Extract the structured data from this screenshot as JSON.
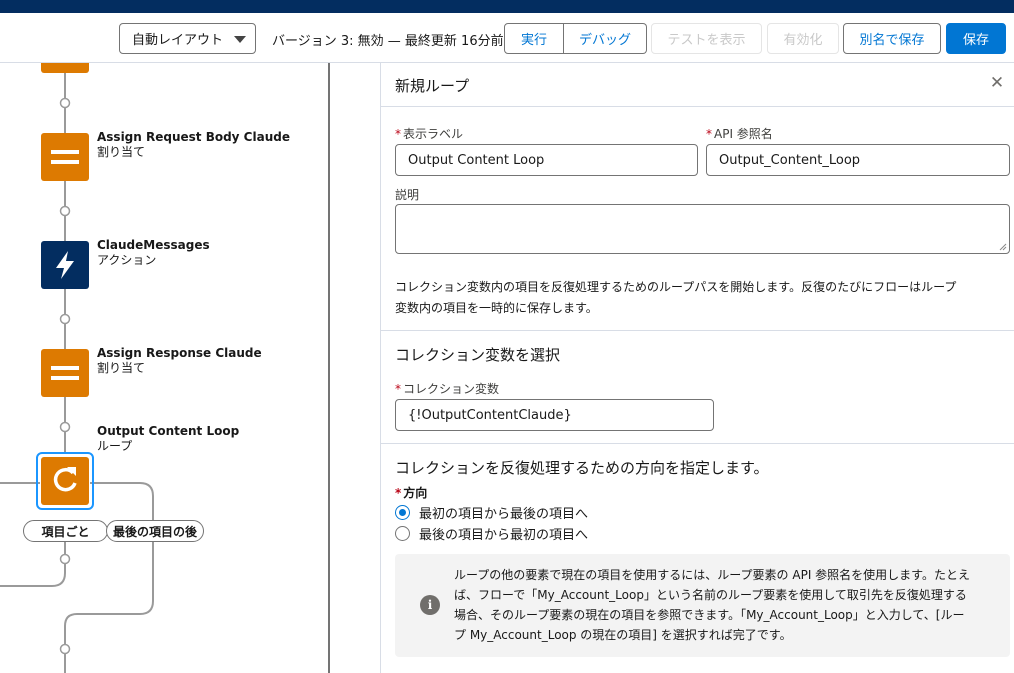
{
  "toolbar": {
    "layout_select_value": "自動レイアウト",
    "version_text": "バージョン 3: 無効 — 最終更新 16分前",
    "run_label": "実行",
    "debug_label": "デバッグ",
    "view_tests_label": "テストを表示",
    "activate_label": "有効化",
    "save_as_label": "別名で保存",
    "save_label": "保存"
  },
  "canvas": {
    "nodes": [
      {
        "title": "Assign Request Body Claude",
        "subtitle": "割り当て",
        "icon": "assignment-icon"
      },
      {
        "title": "ClaudeMessages",
        "subtitle": "アクション",
        "icon": "action-bolt-icon"
      },
      {
        "title": "Assign Response Claude",
        "subtitle": "割り当て",
        "icon": "assignment-icon"
      },
      {
        "title": "Output Content Loop",
        "subtitle": "ループ",
        "icon": "loop-icon"
      }
    ],
    "for_each_label": "項目ごと",
    "after_last_label": "最後の項目の後"
  },
  "panel": {
    "title": "新規ループ",
    "label_field": {
      "label": "表示ラベル",
      "value": "Output Content Loop"
    },
    "api_field": {
      "label": "API 参照名",
      "value": "Output_Content_Loop"
    },
    "description_label": "説明",
    "description_value": "",
    "help_line1": "コレクション変数内の項目を反復処理するためのループパスを開始します。反復のたびにフローはループ",
    "help_line2": "変数内の項目を一時的に保存します。",
    "collection_section_title": "コレクション変数を選択",
    "collection_field": {
      "label": "コレクション変数",
      "value": "{!OutputContentClaude}"
    },
    "direction_section_title": "コレクションを反復処理するための方向を指定します。",
    "direction_label": "方向",
    "direction_options": [
      {
        "label": "最初の項目から最後の項目へ",
        "checked": true
      },
      {
        "label": "最後の項目から最初の項目へ",
        "checked": false
      }
    ],
    "info_line1": "ループの他の要素で現在の項目を使用するには、ループ要素の API 参照名を使用します。たとえ",
    "info_line2": "ば、フローで「My_Account_Loop」という名前のループ要素を使用して取引先を反復処理する",
    "info_line3": "場合、そのループ要素の現在の項目を参照できます。「My_Account_Loop」と入力して、[ルー",
    "info_line4": "プ My_Account_Loop の現在の項目] を選択すれば完了です。"
  },
  "colors": {
    "navy": "#032d60",
    "brand_blue": "#0176d3",
    "assignment_orange": "#dd7a01",
    "action_navy": "#032d60"
  }
}
